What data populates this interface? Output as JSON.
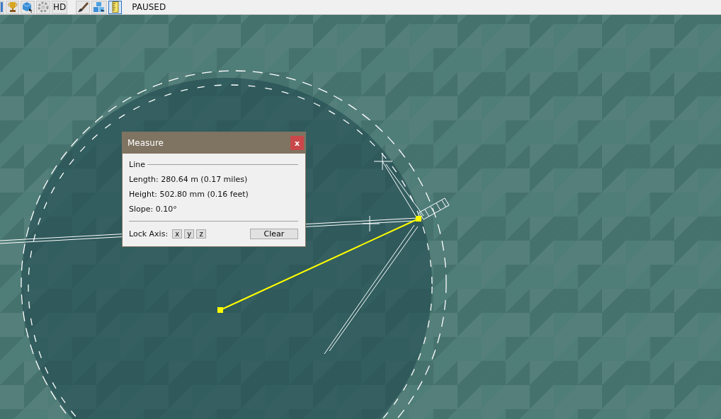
{
  "toolbar": {
    "tools": [
      {
        "kind": "edge",
        "selected": false
      },
      {
        "kind": "trophy",
        "selected": false
      },
      {
        "kind": "cube",
        "selected": false
      },
      {
        "kind": "gear",
        "selected": false
      },
      {
        "kind": "text",
        "label": "HD",
        "selected": false
      },
      {
        "kind": "brush",
        "selected": false
      },
      {
        "kind": "cubes",
        "selected": false
      },
      {
        "kind": "ruler",
        "selected": true
      }
    ],
    "status": "PAUSED"
  },
  "measure_dialog": {
    "title": "Measure",
    "close": "x",
    "section": "Line",
    "readings": [
      "Length: 280.64 m  (0.17 miles)",
      "Height: 502.80 mm  (0.16 feet)",
      "Slope: 0.10°"
    ],
    "lock_axis_label": "Lock Axis:",
    "axes": [
      "x",
      "y",
      "z"
    ],
    "clear_button": "Clear"
  }
}
